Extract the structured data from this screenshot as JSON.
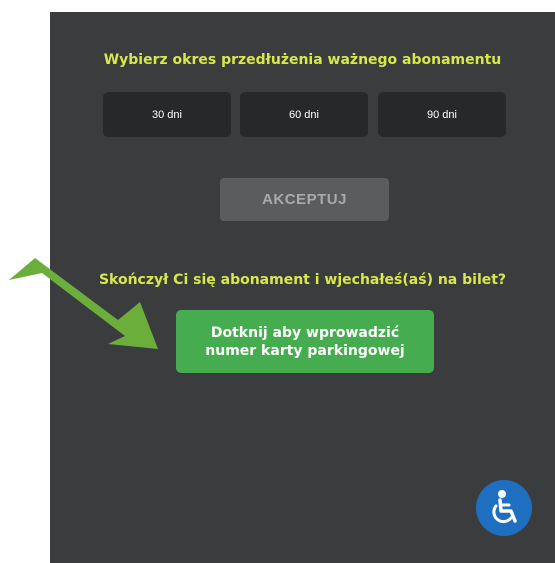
{
  "screen": {
    "top_prompt": "Wybierz okres przedłużenia ważnego abonamentu",
    "periods": [
      {
        "label": "30 dni"
      },
      {
        "label": "60 dni"
      },
      {
        "label": "90 dni"
      }
    ],
    "accept_label": "AKCEPTUJ",
    "bottom_prompt": "Skończył Ci się abonament i wjechałeś(aś) na bilet?",
    "parking_button": {
      "line1": "Dotknij aby wprowadzić",
      "line2": "numer karty parkingowej"
    },
    "accessibility_icon": "wheelchair-icon",
    "annotation_icon": "green-arrow",
    "colors": {
      "background": "#3b3c3e",
      "prompt_text": "#d7e84a",
      "period_button": "#27282a",
      "accept_button_disabled": "#5b5c5e",
      "parking_button": "#45ad4f",
      "accessibility_button": "#1f6fc0",
      "arrow": "#6cae3c"
    }
  }
}
